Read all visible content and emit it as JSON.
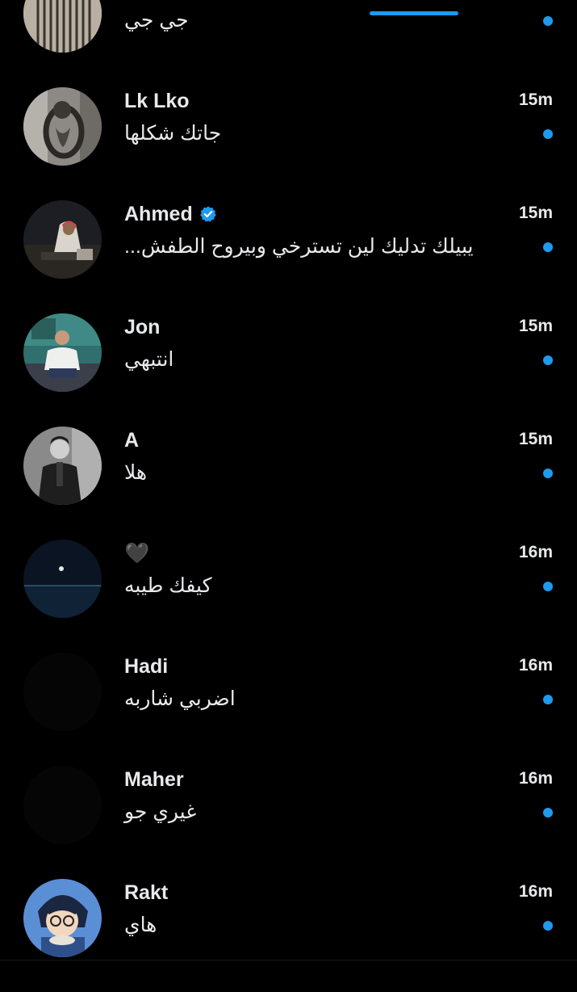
{
  "colors": {
    "background": "#000000",
    "text": "#e7e9ea",
    "accent": "#1d9bf0"
  },
  "conversations": [
    {
      "name": "",
      "time": "",
      "preview": "جي جي",
      "verified": false,
      "unread": true,
      "avatar_icon": "avatar-bars-photo"
    },
    {
      "name": "Lk Lko",
      "time": "15m",
      "preview": "جاتك شكلها",
      "verified": false,
      "unread": true,
      "avatar_icon": "avatar-doorknocker-photo"
    },
    {
      "name": "Ahmed",
      "time": "15m",
      "preview": "يبيلك تدليك لين تسترخي وبيروح الطفش...",
      "verified": true,
      "unread": true,
      "avatar_icon": "avatar-person-photo"
    },
    {
      "name": "Jon",
      "time": "15m",
      "preview": "انتبهي",
      "verified": false,
      "unread": true,
      "avatar_icon": "avatar-seated-man-photo"
    },
    {
      "name": "A",
      "time": "15m",
      "preview": "هلا",
      "verified": false,
      "unread": true,
      "avatar_icon": "avatar-bw-portrait-photo"
    },
    {
      "name": "🖤",
      "time": "16m",
      "preview": "كيفك طيبه",
      "verified": false,
      "unread": true,
      "avatar_icon": "avatar-moon-sea-photo"
    },
    {
      "name": "Hadi",
      "time": "16m",
      "preview": "اضربي شاربه",
      "verified": false,
      "unread": true,
      "avatar_icon": "avatar-blank"
    },
    {
      "name": "Maher",
      "time": "16m",
      "preview": "غيري جو",
      "verified": false,
      "unread": true,
      "avatar_icon": "avatar-blank"
    },
    {
      "name": "Rakt",
      "time": "16m",
      "preview": "هاي",
      "verified": false,
      "unread": true,
      "avatar_icon": "avatar-anime-boy"
    }
  ]
}
